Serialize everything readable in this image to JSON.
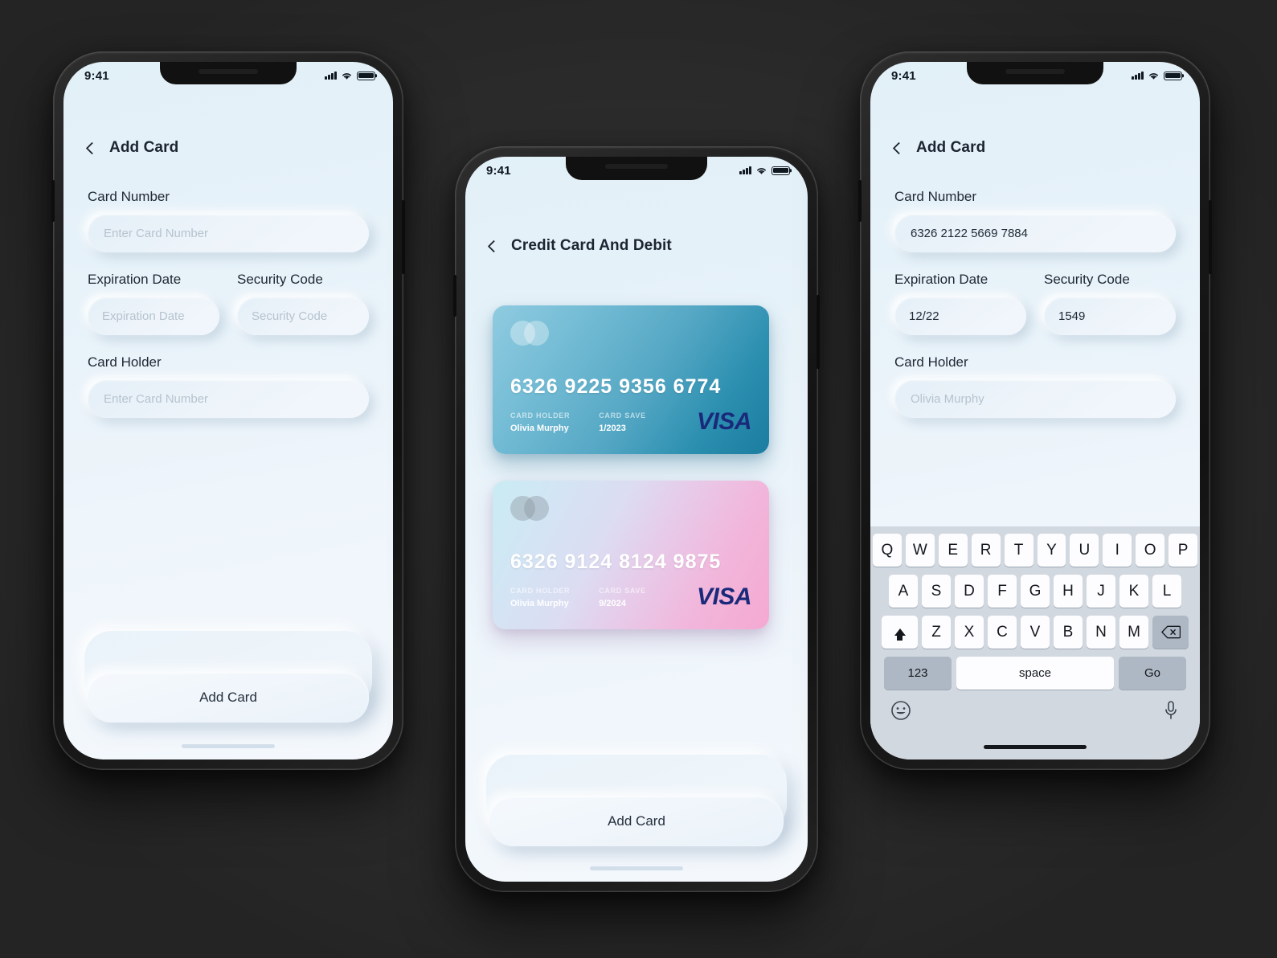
{
  "canvas": {
    "background": "#2b2b2b"
  },
  "theme": {
    "screen_bg_top": "#e2f0f8",
    "screen_bg_bottom": "#f4f8fc",
    "text_dark": "#1b2431",
    "placeholder": "#b6c3ce",
    "visa_navy": "#1a2a7a",
    "card_blue": "#54a7c4",
    "card_pink": "#f2b5da",
    "keyboard_bg": "#d2d8e0"
  },
  "phones": [
    {
      "id": "phone-add-card-empty",
      "status_bar": {
        "time": "9:41",
        "signal_icon": "cellular-signal-icon",
        "wifi_icon": "wifi-icon",
        "battery_icon": "battery-icon"
      },
      "nav": {
        "back_icon": "chevron-left-icon",
        "title": "Add Card"
      },
      "form": {
        "fields": [
          {
            "name": "card-number",
            "label": "Card Number",
            "value": "",
            "placeholder": "Enter Card Number",
            "filled": false
          },
          {
            "name": "expiration-date",
            "label": "Expiration Date",
            "value": "",
            "placeholder": "Expiration Date",
            "filled": false
          },
          {
            "name": "security-code",
            "label": "Security Code",
            "value": "",
            "placeholder": "Security Code",
            "filled": false
          },
          {
            "name": "card-holder",
            "label": "Card Holder",
            "value": "",
            "placeholder": "Enter Card Number",
            "filled": false
          }
        ]
      },
      "primary_button": {
        "label": "Add Card"
      },
      "has_keyboard": false,
      "cards": []
    },
    {
      "id": "phone-credit-card-list",
      "status_bar": {
        "time": "9:41",
        "signal_icon": "cellular-signal-icon",
        "wifi_icon": "wifi-icon",
        "battery_icon": "battery-icon"
      },
      "nav": {
        "back_icon": "chevron-left-icon",
        "title": "Credit Card And Debit"
      },
      "cards": [
        {
          "theme": "blue",
          "number": "6326  9225  9356  6774",
          "holder_caption": "CARD HOLDER",
          "holder_value": "Olivia  Murphy",
          "save_caption": "CARD SAVE",
          "save_value": "1/2023",
          "brand": "VISA"
        },
        {
          "theme": "pink",
          "number": "6326  9124  8124  9875",
          "holder_caption": "CARD HOLDER",
          "holder_value": "Olivia  Murphy",
          "save_caption": "CARD SAVE",
          "save_value": "9/2024",
          "brand": "VISA"
        }
      ],
      "primary_button": {
        "label": "Add Card"
      },
      "has_keyboard": false
    },
    {
      "id": "phone-add-card-filled",
      "status_bar": {
        "time": "9:41",
        "signal_icon": "cellular-signal-icon",
        "wifi_icon": "wifi-icon",
        "battery_icon": "battery-icon"
      },
      "nav": {
        "back_icon": "chevron-left-icon",
        "title": "Add Card"
      },
      "form": {
        "fields": [
          {
            "name": "card-number",
            "label": "Card Number",
            "value": "6326 2122 5669 7884",
            "placeholder": "Enter Card Number",
            "filled": true
          },
          {
            "name": "expiration-date",
            "label": "Expiration Date",
            "value": "12/22",
            "placeholder": "Expiration Date",
            "filled": true
          },
          {
            "name": "security-code",
            "label": "Security Code",
            "value": "1549",
            "placeholder": "Security Code",
            "filled": true
          },
          {
            "name": "card-holder",
            "label": "Card Holder",
            "value": "",
            "placeholder": "Olivia Murphy",
            "filled": false
          }
        ]
      },
      "has_keyboard": true,
      "cards": []
    }
  ],
  "keyboard": {
    "row1": [
      "Q",
      "W",
      "E",
      "R",
      "T",
      "Y",
      "U",
      "I",
      "O",
      "P"
    ],
    "row2": [
      "A",
      "S",
      "D",
      "F",
      "G",
      "H",
      "J",
      "K",
      "L"
    ],
    "row3": [
      "Z",
      "X",
      "C",
      "V",
      "B",
      "N",
      "M"
    ],
    "shift_icon": "shift-arrow-icon",
    "backspace_icon": "backspace-icon",
    "numeric_label": "123",
    "space_label": "space",
    "return_label": "Go",
    "emoji_icon": "emoji-smiley-icon",
    "mic_icon": "microphone-icon"
  }
}
